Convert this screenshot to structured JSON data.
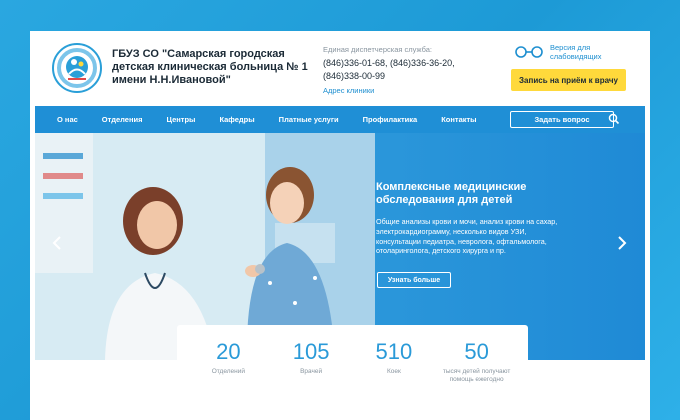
{
  "header": {
    "org_name": [
      "ГБУЗ СО \"Самарская городская",
      "детская клиническая больница № 1",
      "имени Н.Н.Ивановой\""
    ],
    "dispatch_label": "Единая диспетчерская служба:",
    "phones": [
      "(846)336-01-68, (846)336-36-20,",
      "(846)338-00-99"
    ],
    "address_link": "Адрес клиники",
    "vision_label": "Версия для слабовидящих",
    "appointment_button": "Запись на приём к врачу"
  },
  "nav": {
    "items": [
      "О нас",
      "Отделения",
      "Центры",
      "Кафедры",
      "Платные услуги",
      "Профилактика",
      "Контакты"
    ],
    "ask_button": "Задать вопрос",
    "search_icon": "search-icon"
  },
  "hero": {
    "title": [
      "Комплексные медицинские",
      "обследования для детей"
    ],
    "description": [
      "Общие анализы крови и мочи, анализ крови на сахар,",
      "электрокардиограмму, несколько видов УЗИ,",
      "консультации педиатра, невролога, офтальмолога,",
      "отоларинголога, детского хирурга и пр."
    ],
    "more_button": "Узнать больше"
  },
  "stats": [
    {
      "value": "20",
      "label": [
        "Отделений"
      ]
    },
    {
      "value": "105",
      "label": [
        "Врачей"
      ]
    },
    {
      "value": "510",
      "label": [
        "Коек"
      ]
    },
    {
      "value": "50",
      "label": [
        "тысяч детей получают",
        "помощь ежегодно"
      ]
    }
  ],
  "colors": {
    "background": "#1d9ad6",
    "nav": "#1f8fd6",
    "accent_yellow": "#ffd93b",
    "link_blue": "#1e8fd0",
    "stat_blue": "#2a9ad8"
  }
}
